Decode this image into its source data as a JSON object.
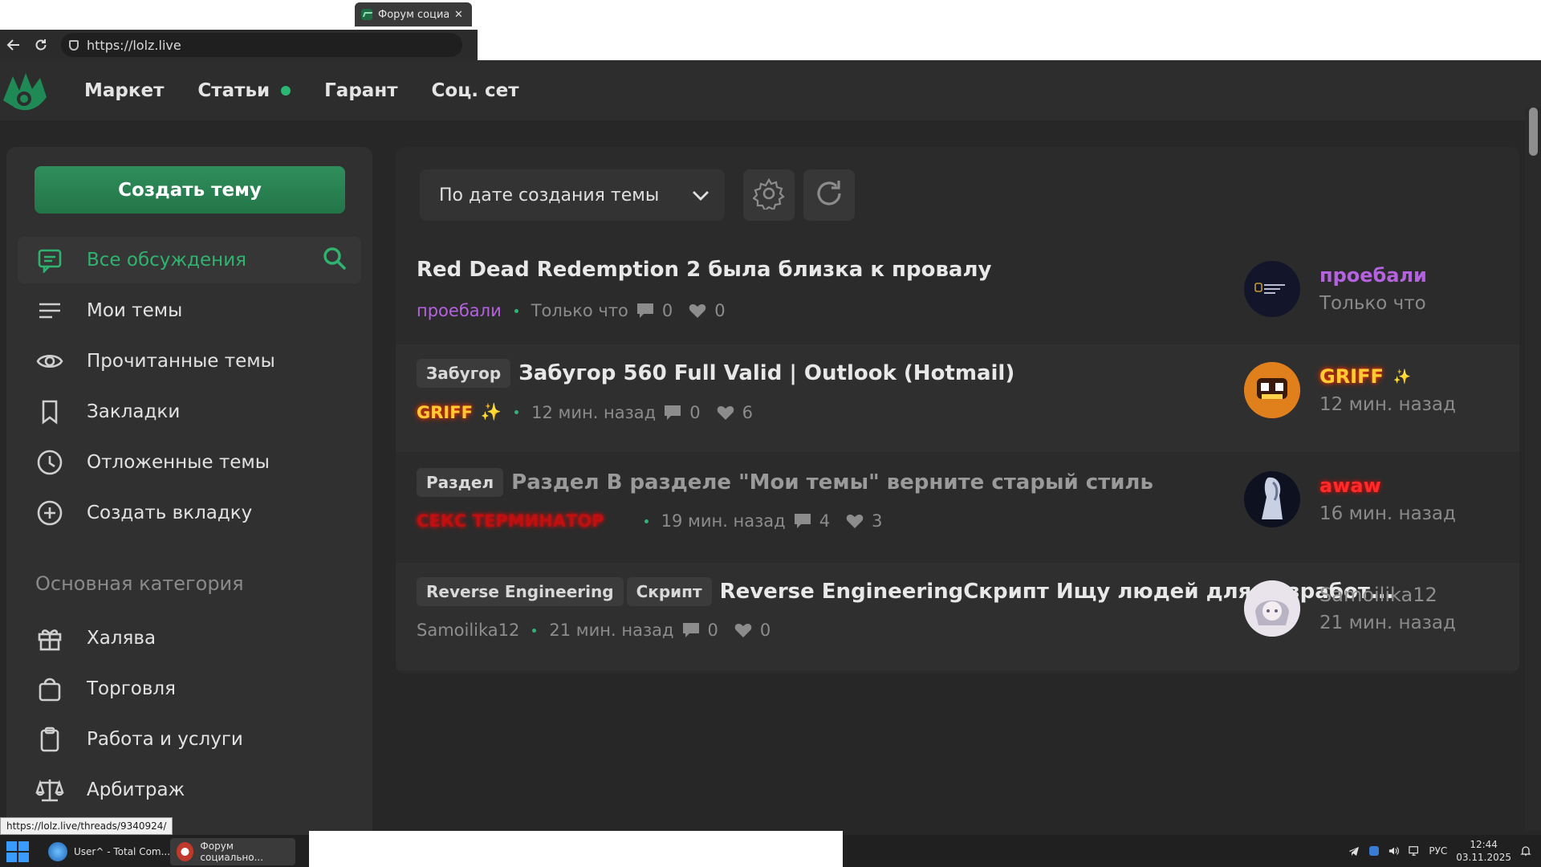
{
  "browser": {
    "tab_title": "Форум социа",
    "url": "https://lolz.live"
  },
  "nav": {
    "items": [
      "Маркет",
      "Статьи",
      "Гарант",
      "Соц. сет"
    ]
  },
  "sidebar": {
    "create_button": "Создать тему",
    "items": [
      {
        "label": "Все обсуждения",
        "icon": "chat-icon"
      },
      {
        "label": "Мои темы",
        "icon": "list-icon"
      },
      {
        "label": "Прочитанные темы",
        "icon": "eye-icon"
      },
      {
        "label": "Закладки",
        "icon": "bookmark-icon"
      },
      {
        "label": "Отложенные темы",
        "icon": "clock-icon"
      },
      {
        "label": "Создать вкладку",
        "icon": "plus-circle-icon"
      }
    ],
    "category_heading": "Основная категория",
    "categories": [
      {
        "label": "Халява",
        "icon": "gift-icon"
      },
      {
        "label": "Торговля",
        "icon": "bag-icon"
      },
      {
        "label": "Работа и услуги",
        "icon": "clipboard-icon"
      },
      {
        "label": "Арбитраж",
        "icon": "scales-icon"
      }
    ]
  },
  "toolbar": {
    "sort_label": "По дате создания темы"
  },
  "threads": [
    {
      "prefixes": [],
      "title": "Red Dead Redemption 2 была близка к провалу",
      "author": "проебали",
      "time": "Только что",
      "replies": "0",
      "likes": "0",
      "last_user": "проебали",
      "last_time": "Только что"
    },
    {
      "prefixes": [
        "Забугор"
      ],
      "title": "Забугор 560 Full Valid | Outlook (Hotmail)",
      "author": "GRIFF",
      "time": "12 мин. назад",
      "replies": "0",
      "likes": "6",
      "last_user": "GRIFF",
      "last_time": "12 мин. назад"
    },
    {
      "prefixes": [
        "Раздел"
      ],
      "title": "Раздел В разделе \"Мои темы\" верните старый стиль",
      "author": "СЕКС ТЕРМИНАТОР",
      "time": "19 мин. назад",
      "replies": "4",
      "likes": "3",
      "last_user": "awaw",
      "last_time": "16 мин. назад"
    },
    {
      "prefixes": [
        "Reverse Engineering",
        "Скрипт"
      ],
      "title": "Reverse EngineeringСкрипт Ищу людей для разработ...",
      "author": "Samoilika12",
      "time": "21 мин. назад",
      "replies": "0",
      "likes": "0",
      "last_user": "Samoilika12",
      "last_time": "21 мин. назад"
    }
  ],
  "status_url": "https://lolz.live/threads/9340924/",
  "taskbar": {
    "items": [
      "User^ - Total Com...",
      "Форум социально..."
    ],
    "lang": "РУС",
    "time": "12:44",
    "date": "03.11.2025"
  },
  "colors": {
    "accent_green": "#2bb673",
    "purple_user": "#b562e0"
  }
}
